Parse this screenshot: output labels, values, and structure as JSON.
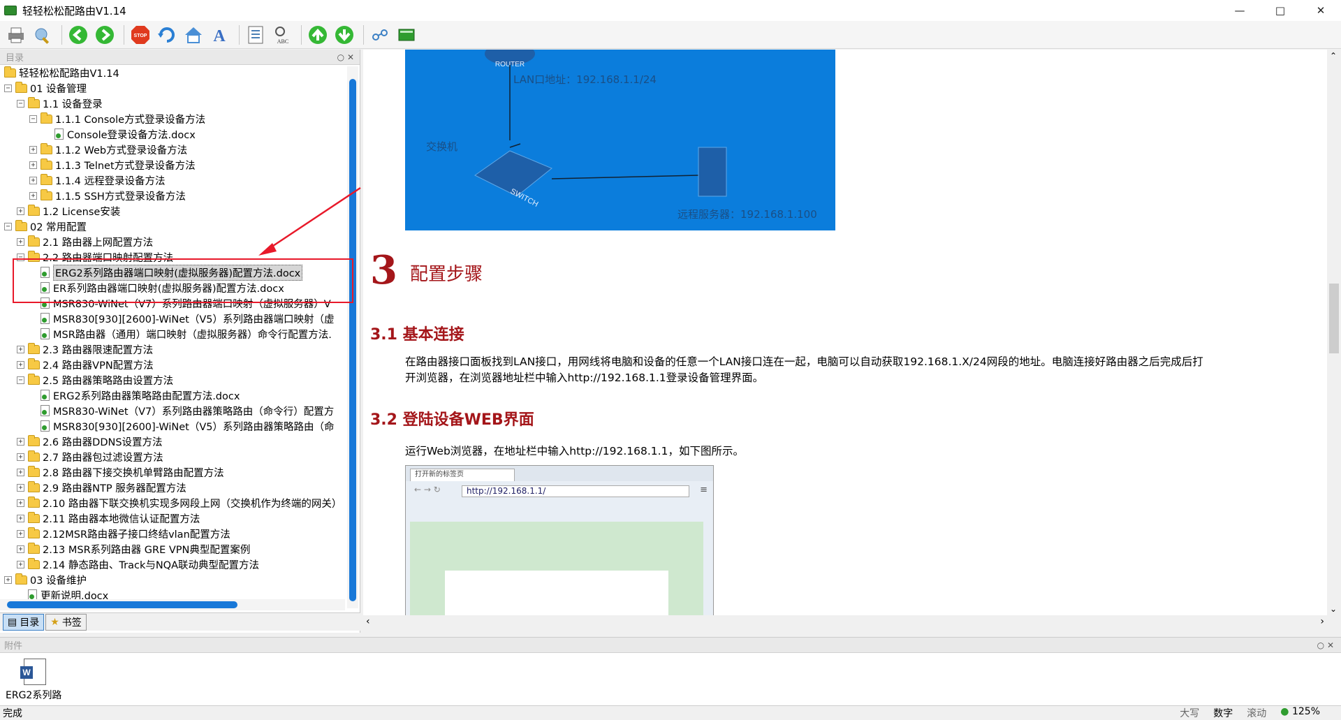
{
  "window": {
    "title": "轻轻松松配路由V1.14"
  },
  "toolbar": {
    "buttons": [
      "print",
      "settings",
      "back",
      "forward",
      "stop",
      "refresh",
      "home",
      "font",
      "contents",
      "spellcheck",
      "up",
      "down",
      "link",
      "book"
    ],
    "stop_label": "STOP",
    "spell_label": "ABC"
  },
  "left_pane": {
    "header": "目录",
    "tree": [
      {
        "level": 0,
        "type": "folder",
        "exp": "",
        "label": "轻轻松松配路由V1.14"
      },
      {
        "level": 0,
        "type": "folder",
        "exp": "−",
        "label": "01 设备管理"
      },
      {
        "level": 1,
        "type": "folder",
        "exp": "−",
        "label": "1.1 设备登录"
      },
      {
        "level": 2,
        "type": "folder",
        "exp": "−",
        "label": "1.1.1 Console方式登录设备方法"
      },
      {
        "level": 3,
        "type": "doc",
        "exp": "",
        "label": "Console登录设备方法.docx"
      },
      {
        "level": 2,
        "type": "folder",
        "exp": "+",
        "label": "1.1.2 Web方式登录设备方法"
      },
      {
        "level": 2,
        "type": "folder",
        "exp": "+",
        "label": "1.1.3 Telnet方式登录设备方法"
      },
      {
        "level": 2,
        "type": "folder",
        "exp": "+",
        "label": "1.1.4 远程登录设备方法"
      },
      {
        "level": 2,
        "type": "folder",
        "exp": "+",
        "label": "1.1.5 SSH方式登录设备方法"
      },
      {
        "level": 1,
        "type": "folder",
        "exp": "+",
        "label": "1.2 License安装"
      },
      {
        "level": 0,
        "type": "folder",
        "exp": "−",
        "label": "02 常用配置"
      },
      {
        "level": 1,
        "type": "folder",
        "exp": "+",
        "label": "2.1 路由器上网配置方法"
      },
      {
        "level": 1,
        "type": "folder",
        "exp": "−",
        "label": "2.2 路由器端口映射配置方法"
      },
      {
        "level": 2,
        "type": "doc",
        "exp": "",
        "label": "ERG2系列路由器端口映射(虚拟服务器)配置方法.docx",
        "selected": true
      },
      {
        "level": 2,
        "type": "doc",
        "exp": "",
        "label": "ER系列路由器端口映射(虚拟服务器)配置方法.docx"
      },
      {
        "level": 2,
        "type": "doc",
        "exp": "",
        "label": "MSR830-WiNet（V7）系列路由器端口映射（虚拟服务器）V"
      },
      {
        "level": 2,
        "type": "doc",
        "exp": "",
        "label": "MSR830[930][2600]-WiNet（V5）系列路由器端口映射（虚"
      },
      {
        "level": 2,
        "type": "doc",
        "exp": "",
        "label": "MSR路由器（通用）端口映射（虚拟服务器）命令行配置方法."
      },
      {
        "level": 1,
        "type": "folder",
        "exp": "+",
        "label": "2.3 路由器限速配置方法"
      },
      {
        "level": 1,
        "type": "folder",
        "exp": "+",
        "label": "2.4 路由器VPN配置方法"
      },
      {
        "level": 1,
        "type": "folder",
        "exp": "−",
        "label": "2.5 路由器策略路由设置方法"
      },
      {
        "level": 2,
        "type": "doc",
        "exp": "",
        "label": "ERG2系列路由器策略路由配置方法.docx"
      },
      {
        "level": 2,
        "type": "doc",
        "exp": "",
        "label": "MSR830-WiNet（V7）系列路由器策略路由（命令行）配置方"
      },
      {
        "level": 2,
        "type": "doc",
        "exp": "",
        "label": "MSR830[930][2600]-WiNet（V5）系列路由器策略路由（命"
      },
      {
        "level": 1,
        "type": "folder",
        "exp": "+",
        "label": "2.6 路由器DDNS设置方法"
      },
      {
        "level": 1,
        "type": "folder",
        "exp": "+",
        "label": "2.7 路由器包过滤设置方法"
      },
      {
        "level": 1,
        "type": "folder",
        "exp": "+",
        "label": "2.8 路由器下接交换机单臂路由配置方法"
      },
      {
        "level": 1,
        "type": "folder",
        "exp": "+",
        "label": "2.9 路由器NTP 服务器配置方法"
      },
      {
        "level": 1,
        "type": "folder",
        "exp": "+",
        "label": "2.10 路由器下联交换机实现多网段上网（交换机作为终端的网关）"
      },
      {
        "level": 1,
        "type": "folder",
        "exp": "+",
        "label": "2.11 路由器本地微信认证配置方法"
      },
      {
        "level": 1,
        "type": "folder",
        "exp": "+",
        "label": "2.12MSR路由器子接口终结vlan配置方法"
      },
      {
        "level": 1,
        "type": "folder",
        "exp": "+",
        "label": "2.13 MSR系列路由器 GRE VPN典型配置案例"
      },
      {
        "level": 1,
        "type": "folder",
        "exp": "+",
        "label": "2.14 静态路由、Track与NQA联动典型配置方法"
      },
      {
        "level": 0,
        "type": "folder",
        "exp": "+",
        "label": "03 设备维护"
      },
      {
        "level": 1,
        "type": "doc",
        "exp": "",
        "label": "更新说明.docx"
      }
    ],
    "tabs": [
      "目录",
      "书签"
    ]
  },
  "content": {
    "diagram": {
      "router_label": "ROUTER",
      "lan_label": "LAN口地址：192.168.1.1/24",
      "switch_caption": "交换机",
      "switch_label": "SWITCH",
      "server_label": "远程服务器：192.168.1.100"
    },
    "section_num": "3",
    "section_title": "配置步骤",
    "sub1": "3.1 基本连接",
    "para1_a": "在路由器接口面板找到LAN接口，用网线将电脑和设备的任意一个LAN接口连在一起，电脑可以自动获取192.168.1.X/24网段的地址。电脑连接好路由器之后完成后打",
    "para1_b": "开浏览器，在浏览器地址栏中输入http://192.168.1.1登录设备管理界面。",
    "sub2": "3.2 登陆设备WEB界面",
    "para2": "运行Web浏览器，在地址栏中输入http://192.168.1.1，如下图所示。",
    "browser": {
      "tab_label": "打开新的标签页",
      "address": "http://192.168.1.1/"
    }
  },
  "attachments": {
    "header": "附件",
    "file_name": "ERG2系列路",
    "file_icon": "word-doc-icon"
  },
  "status": {
    "left": "完成",
    "caps": "大写",
    "num": "数字",
    "scroll": "滚动",
    "zoom": "125%"
  },
  "colors": {
    "accent": "#1878d8",
    "heading": "#a4161a",
    "diagram_bg": "#0b7ddc",
    "highlight_box": "#e8192a"
  }
}
